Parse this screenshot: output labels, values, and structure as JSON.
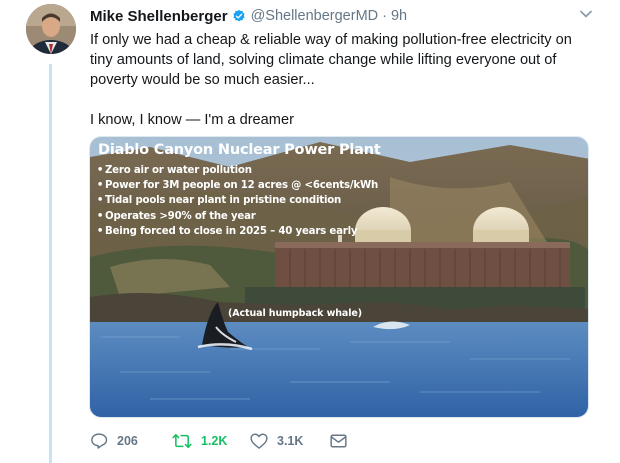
{
  "author": {
    "display_name": "Mike Shellenberger",
    "handle": "@ShellenbergerMD",
    "separator": "·",
    "time": "9h",
    "verified": true
  },
  "tweet": {
    "text_line1": "If only we had a cheap & reliable way of making pollution-free electricity on tiny amounts of land, solving climate change while lifting everyone out of poverty would be so much easier...",
    "text_line2": "I know, I know — I'm a dreamer"
  },
  "media": {
    "title": "Diablo Canyon Nuclear Power Plant",
    "bullets": [
      "Zero air or water pollution",
      "Power for 3M people on 12 acres @ <6cents/kWh",
      "Tidal pools near plant in pristine condition",
      "Operates >90% of the year",
      "Being forced to close in 2025 – 40 years early"
    ],
    "whale_caption": "(Actual humpback whale)"
  },
  "actions": {
    "reply_count": "206",
    "retweet_count": "1.2K",
    "like_count": "3.1K",
    "icons": [
      "reply-icon",
      "retweet-icon",
      "like-icon",
      "dm-icon",
      "caret-icon",
      "verified-badge-icon"
    ]
  },
  "colors": {
    "accent": "#1da1f2",
    "retweet_active": "#17bf63",
    "secondary_text": "#657786",
    "thread_line": "#c4e3f3"
  }
}
